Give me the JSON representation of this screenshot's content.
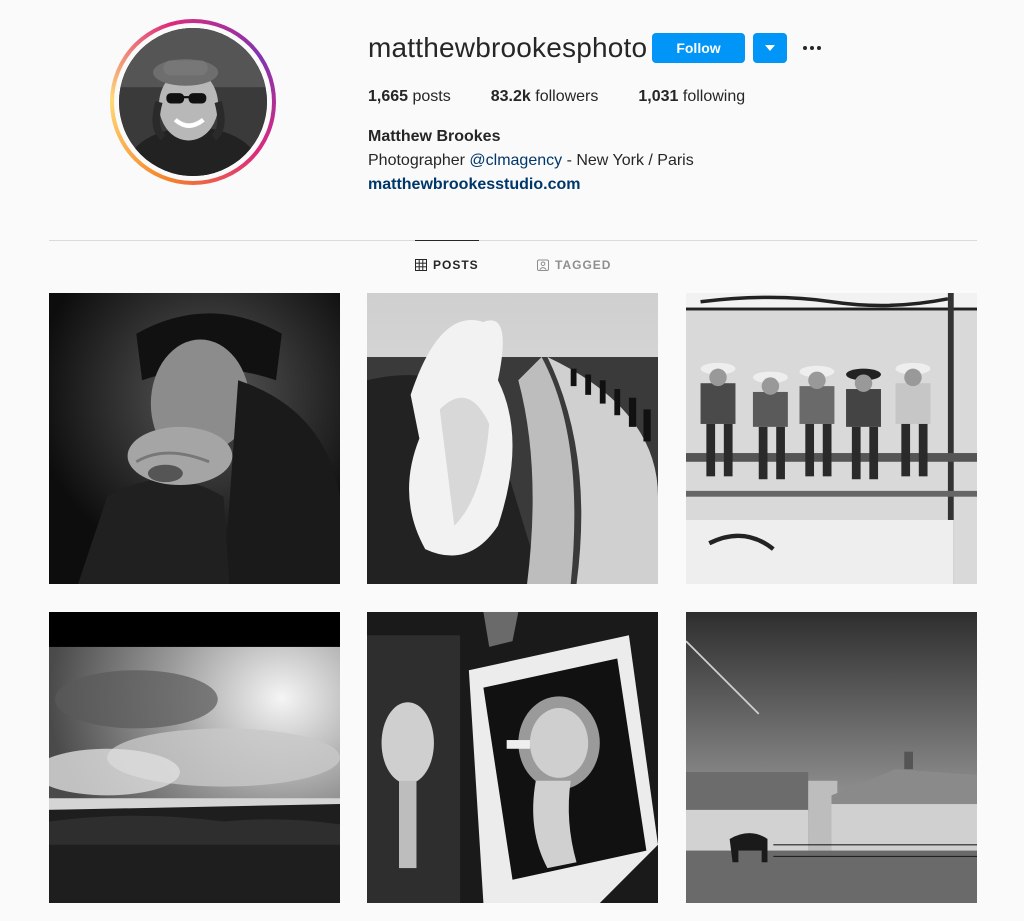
{
  "profile": {
    "username": "matthewbrookesphoto",
    "follow_label": "Follow",
    "stats": {
      "posts_count": "1,665",
      "posts_label": "posts",
      "followers_count": "83.2k",
      "followers_label": "followers",
      "following_count": "1,031",
      "following_label": "following"
    },
    "full_name": "Matthew Brookes",
    "bio": {
      "prefix": "Photographer ",
      "mention": "@clmagency",
      "suffix": " - New York / Paris"
    },
    "website": "matthewbrookesstudio.com"
  },
  "tabs": [
    {
      "label": "POSTS",
      "icon": "grid-icon",
      "active": true
    },
    {
      "label": "TAGGED",
      "icon": "tagged-icon",
      "active": false
    }
  ],
  "posts": [
    {
      "subject": "man-portrait-leather-jacket"
    },
    {
      "subject": "ocean-wave-crashing-seawall"
    },
    {
      "subject": "cowboys-on-rodeo-fence"
    },
    {
      "subject": "misty-landscape"
    },
    {
      "subject": "xray-skull-print"
    },
    {
      "subject": "horse-barn-landscape"
    }
  ],
  "colors": {
    "accent": "#0095f6",
    "link": "#00376b",
    "text": "#262626",
    "muted": "#8e8e8e",
    "background": "#fafafa",
    "divider": "#dbdbdb"
  }
}
